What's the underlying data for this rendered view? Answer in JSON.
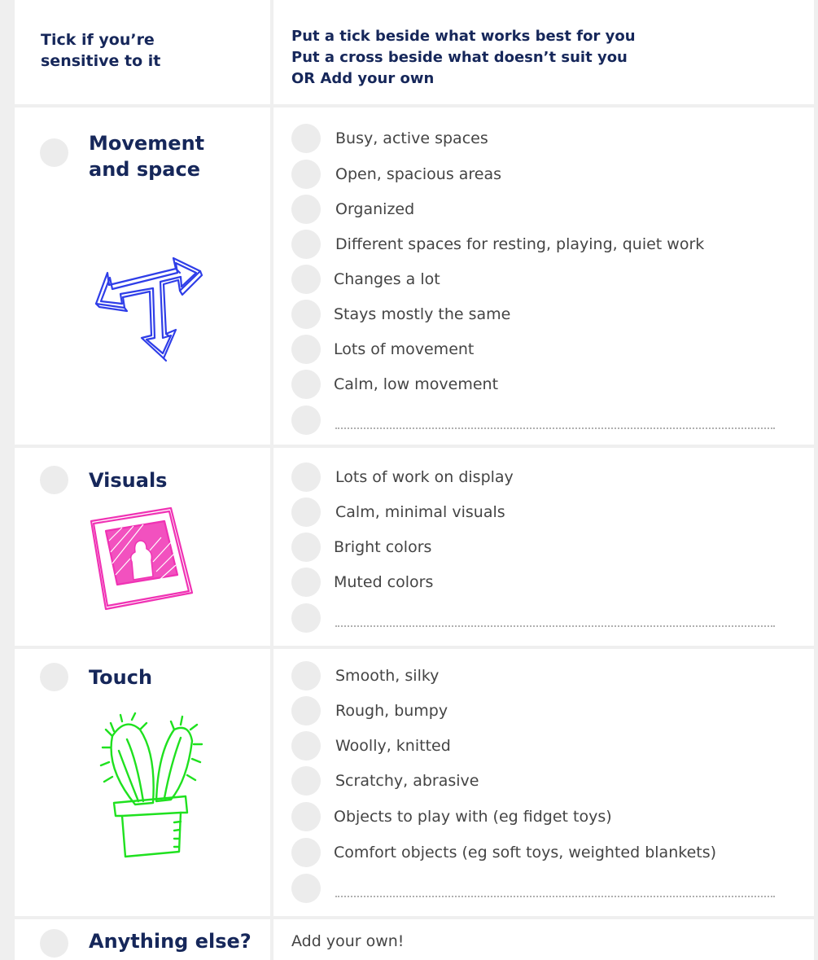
{
  "header": {
    "left_line1": "Tick if you’re",
    "left_line2": "sensitive to it",
    "right_line1": "Put a tick beside what works best for you",
    "right_line2": "Put a cross beside what doesn’t suit you",
    "right_or": "OR",
    "right_line3": "Add your own"
  },
  "sections": {
    "movement": {
      "title_line1": "Movement",
      "title_line2": "and space",
      "icon": "crossroad-arrows-icon",
      "icon_color": "#2f3ee8",
      "options": [
        "Busy, active spaces",
        "Open, spacious areas",
        "Organized",
        "Different spaces for resting, playing, quiet work",
        "Changes a lot",
        "Stays mostly the same",
        "Lots of movement",
        "Calm, low movement"
      ]
    },
    "visuals": {
      "title": "Visuals",
      "icon": "picture-frame-icon",
      "icon_color": "#f032b4",
      "options": [
        "Lots of work on display",
        "Calm, minimal visuals",
        "Bright colors",
        "Muted colors"
      ]
    },
    "touch": {
      "title": "Touch",
      "icon": "cactus-icon",
      "icon_color": "#1fe11f",
      "options": [
        "Smooth, silky",
        "Rough, bumpy",
        "Woolly, knitted",
        "Scratchy, abrasive",
        "Objects to play with (eg fidget toys)",
        "Comfort objects (eg soft toys, weighted blankets)"
      ]
    },
    "anything": {
      "title": "Anything else?",
      "text": "Add your own!"
    }
  },
  "colors": {
    "heading": "#16275a",
    "body_text": "#444444",
    "circle": "#ececec",
    "divider": "#efefef"
  }
}
